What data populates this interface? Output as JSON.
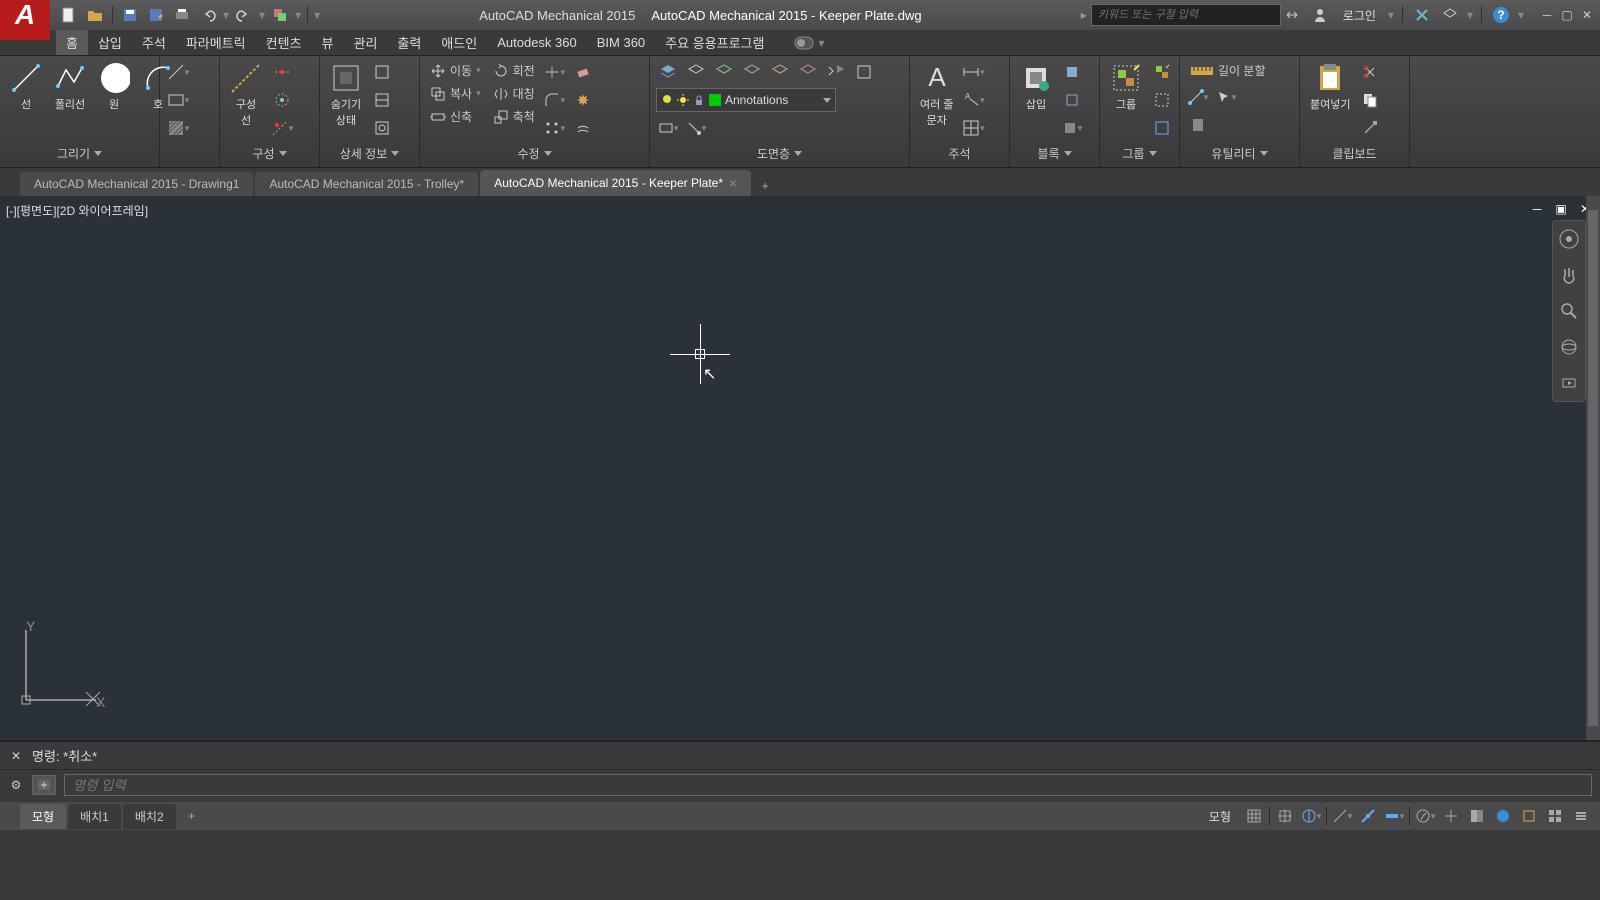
{
  "title": {
    "app": "AutoCAD Mechanical 2015",
    "doc": "AutoCAD Mechanical 2015 - Keeper Plate.dwg",
    "search_placeholder": "키워드 또는 구절 입력",
    "login": "로그인"
  },
  "menu": {
    "items": [
      "홈",
      "삽입",
      "주석",
      "파라메트릭",
      "컨텐츠",
      "뷰",
      "관리",
      "출력",
      "애드인",
      "Autodesk 360",
      "BIM 360",
      "주요 응용프로그램"
    ]
  },
  "ribbon": {
    "draw": {
      "title": "그리기",
      "line": "선",
      "polyline": "폴리선",
      "circle": "원",
      "arc": "호",
      "construction": "구성\n선"
    },
    "detail": {
      "title": "상세 정보",
      "hide": "숨기기\n상태"
    },
    "modify": {
      "title": "수정",
      "move": "이동",
      "rotate": "회전",
      "copy": "복사",
      "mirror": "대칭",
      "stretch": "신축",
      "scale": "축척"
    },
    "layer": {
      "title": "도면층",
      "combo": "Annotations"
    },
    "annotation": {
      "title": "주석",
      "multi": "여러 줄\n문자"
    },
    "block": {
      "title": "블록",
      "insert": "삽입"
    },
    "group": {
      "title": "그룹",
      "group": "그룹"
    },
    "utility": {
      "title": "유틸리티",
      "dist": "길이 분할"
    },
    "clipboard": {
      "title": "클립보드",
      "paste": "붙여넣기"
    },
    "construction_panel": "구성"
  },
  "tabs": {
    "drawing": [
      {
        "label": "AutoCAD Mechanical 2015 - Drawing1",
        "active": false
      },
      {
        "label": "AutoCAD Mechanical 2015 - Trolley*",
        "active": false
      },
      {
        "label": "AutoCAD Mechanical 2015 - Keeper Plate*",
        "active": true
      }
    ]
  },
  "viewport": {
    "label": "[-][평면도][2D 와이어프레임]",
    "ucs_x": "X",
    "ucs_y": "Y"
  },
  "command": {
    "prompt": "명령:",
    "last": "*취소*",
    "placeholder": "명령 입력"
  },
  "layout": {
    "tabs": [
      "모형",
      "배치1",
      "배치2"
    ],
    "model_status": "모형"
  }
}
